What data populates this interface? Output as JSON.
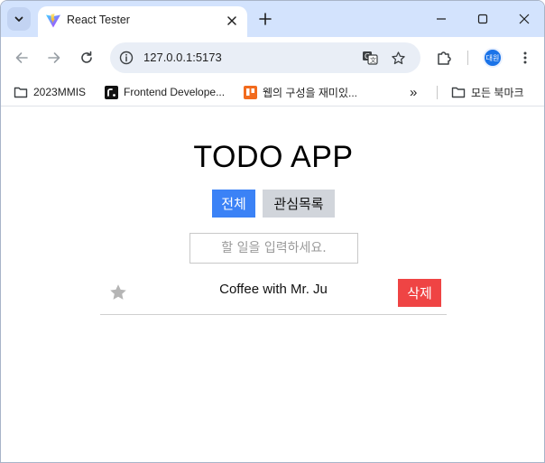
{
  "browser": {
    "tab": {
      "title": "React Tester"
    },
    "address_bar": {
      "url": "127.0.0.1:5173"
    },
    "profile": {
      "initials": "대원"
    },
    "bookmarks": [
      {
        "label": "2023MMIS",
        "icon": "folder-icon"
      },
      {
        "label": "Frontend Develope...",
        "icon": "roadmap-favicon"
      },
      {
        "label": "웹의 구성을 재미있...",
        "icon": "orange-favicon"
      }
    ],
    "more_bookmarks": "»",
    "all_bookmarks": {
      "label": "모든 북마크",
      "icon": "folder-icon"
    }
  },
  "app": {
    "title": "TODO APP",
    "filters": {
      "all": "전체",
      "favorites": "관심목록"
    },
    "input": {
      "placeholder": "할 일을 입력하세요."
    },
    "todos": [
      {
        "text": "Coffee with Mr. Ju",
        "starred": false,
        "delete_label": "삭제"
      }
    ]
  },
  "colors": {
    "filter_active": "#3b82f6",
    "filter_inactive": "#d1d5db",
    "delete": "#ef4444",
    "star_inactive": "#b5b5b5"
  }
}
